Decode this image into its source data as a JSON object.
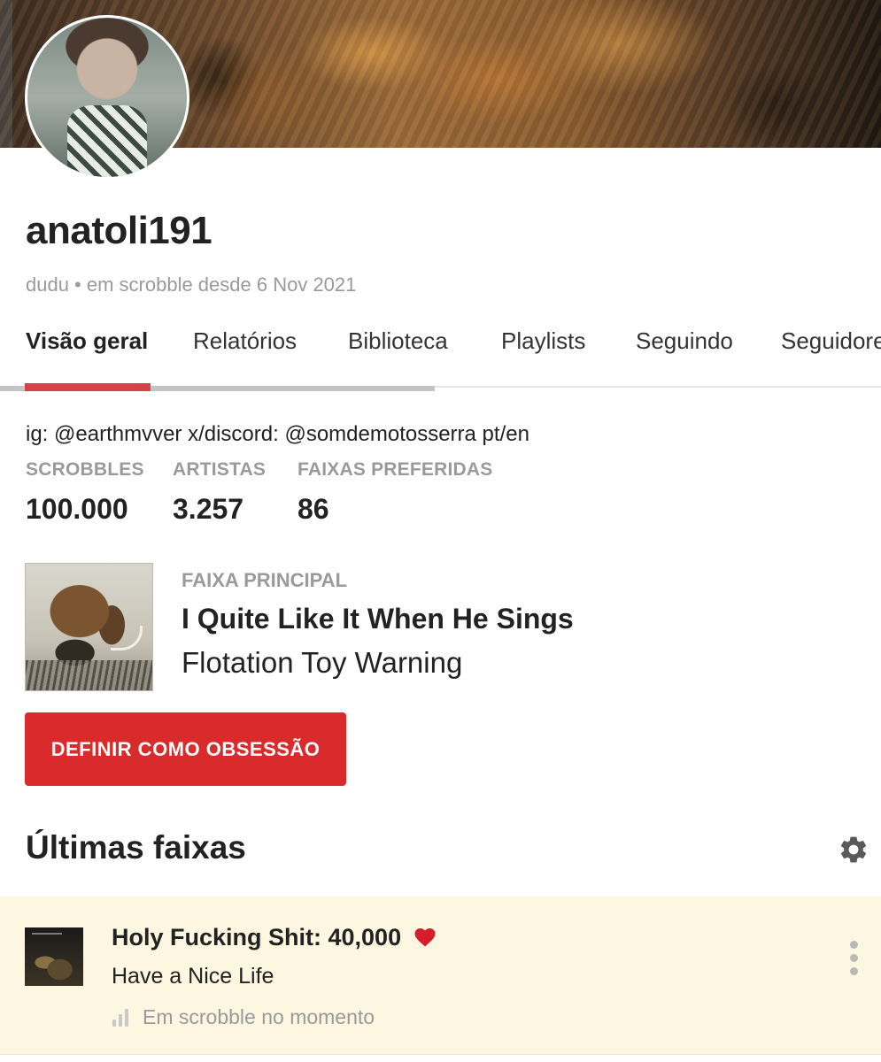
{
  "profile": {
    "username": "anatoli191",
    "subline": "dudu • em scrobble desde 6 Nov 2021",
    "bio": "ig: @earthmvver x/discord: @somdemotosserra pt/en"
  },
  "tabs": [
    {
      "label": "Visão geral",
      "active": true
    },
    {
      "label": "Relatórios",
      "active": false
    },
    {
      "label": "Biblioteca",
      "active": false
    },
    {
      "label": "Playlists",
      "active": false
    },
    {
      "label": "Seguindo",
      "active": false
    },
    {
      "label": "Seguidores",
      "active": false
    }
  ],
  "stats": [
    {
      "label": "SCROBBLES",
      "value": "100.000"
    },
    {
      "label": "ARTISTAS",
      "value": "3.257"
    },
    {
      "label": "FAIXAS PREFERIDAS",
      "value": "86"
    }
  ],
  "top_track": {
    "label": "FAIXA PRINCIPAL",
    "title": "I Quite Like It When He Sings",
    "artist": "Flotation Toy Warning"
  },
  "obsession_button": "DEFINIR COMO OBSESSÃO",
  "recent": {
    "title": "Últimas faixas",
    "tracks": [
      {
        "title": "Holy Fucking Shit: 40,000",
        "artist": "Have a Nice Life",
        "status": "Em scrobble no momento",
        "loved": true
      }
    ]
  },
  "colors": {
    "accent": "#d92b2b",
    "tab_indicator": "#d5434a",
    "now_playing_bg": "#fdf7e1",
    "muted_text": "#9a9a9a",
    "heart": "#d51e2a"
  },
  "icons": {
    "settings": "gear-icon",
    "loved": "heart-icon",
    "now_playing": "equalizer-bars-icon",
    "more": "kebab-menu-icon"
  }
}
